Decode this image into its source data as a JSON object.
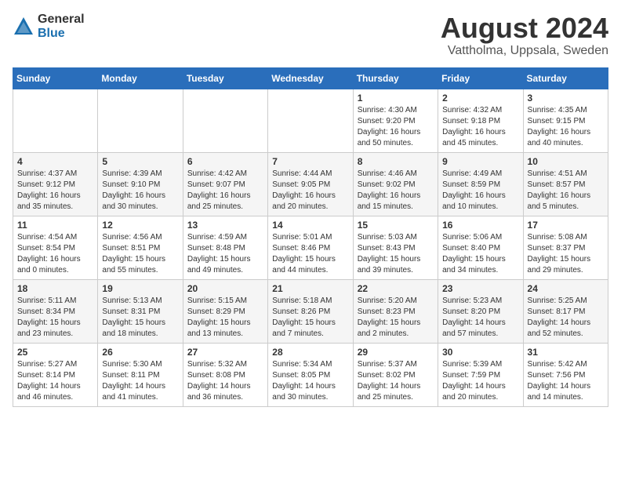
{
  "logo": {
    "general": "General",
    "blue": "Blue"
  },
  "title": "August 2024",
  "location": "Vattholma, Uppsala, Sweden",
  "days_header": [
    "Sunday",
    "Monday",
    "Tuesday",
    "Wednesday",
    "Thursday",
    "Friday",
    "Saturday"
  ],
  "weeks": [
    [
      {
        "day": "",
        "info": ""
      },
      {
        "day": "",
        "info": ""
      },
      {
        "day": "",
        "info": ""
      },
      {
        "day": "",
        "info": ""
      },
      {
        "day": "1",
        "info": "Sunrise: 4:30 AM\nSunset: 9:20 PM\nDaylight: 16 hours\nand 50 minutes."
      },
      {
        "day": "2",
        "info": "Sunrise: 4:32 AM\nSunset: 9:18 PM\nDaylight: 16 hours\nand 45 minutes."
      },
      {
        "day": "3",
        "info": "Sunrise: 4:35 AM\nSunset: 9:15 PM\nDaylight: 16 hours\nand 40 minutes."
      }
    ],
    [
      {
        "day": "4",
        "info": "Sunrise: 4:37 AM\nSunset: 9:12 PM\nDaylight: 16 hours\nand 35 minutes."
      },
      {
        "day": "5",
        "info": "Sunrise: 4:39 AM\nSunset: 9:10 PM\nDaylight: 16 hours\nand 30 minutes."
      },
      {
        "day": "6",
        "info": "Sunrise: 4:42 AM\nSunset: 9:07 PM\nDaylight: 16 hours\nand 25 minutes."
      },
      {
        "day": "7",
        "info": "Sunrise: 4:44 AM\nSunset: 9:05 PM\nDaylight: 16 hours\nand 20 minutes."
      },
      {
        "day": "8",
        "info": "Sunrise: 4:46 AM\nSunset: 9:02 PM\nDaylight: 16 hours\nand 15 minutes."
      },
      {
        "day": "9",
        "info": "Sunrise: 4:49 AM\nSunset: 8:59 PM\nDaylight: 16 hours\nand 10 minutes."
      },
      {
        "day": "10",
        "info": "Sunrise: 4:51 AM\nSunset: 8:57 PM\nDaylight: 16 hours\nand 5 minutes."
      }
    ],
    [
      {
        "day": "11",
        "info": "Sunrise: 4:54 AM\nSunset: 8:54 PM\nDaylight: 16 hours\nand 0 minutes."
      },
      {
        "day": "12",
        "info": "Sunrise: 4:56 AM\nSunset: 8:51 PM\nDaylight: 15 hours\nand 55 minutes."
      },
      {
        "day": "13",
        "info": "Sunrise: 4:59 AM\nSunset: 8:48 PM\nDaylight: 15 hours\nand 49 minutes."
      },
      {
        "day": "14",
        "info": "Sunrise: 5:01 AM\nSunset: 8:46 PM\nDaylight: 15 hours\nand 44 minutes."
      },
      {
        "day": "15",
        "info": "Sunrise: 5:03 AM\nSunset: 8:43 PM\nDaylight: 15 hours\nand 39 minutes."
      },
      {
        "day": "16",
        "info": "Sunrise: 5:06 AM\nSunset: 8:40 PM\nDaylight: 15 hours\nand 34 minutes."
      },
      {
        "day": "17",
        "info": "Sunrise: 5:08 AM\nSunset: 8:37 PM\nDaylight: 15 hours\nand 29 minutes."
      }
    ],
    [
      {
        "day": "18",
        "info": "Sunrise: 5:11 AM\nSunset: 8:34 PM\nDaylight: 15 hours\nand 23 minutes."
      },
      {
        "day": "19",
        "info": "Sunrise: 5:13 AM\nSunset: 8:31 PM\nDaylight: 15 hours\nand 18 minutes."
      },
      {
        "day": "20",
        "info": "Sunrise: 5:15 AM\nSunset: 8:29 PM\nDaylight: 15 hours\nand 13 minutes."
      },
      {
        "day": "21",
        "info": "Sunrise: 5:18 AM\nSunset: 8:26 PM\nDaylight: 15 hours\nand 7 minutes."
      },
      {
        "day": "22",
        "info": "Sunrise: 5:20 AM\nSunset: 8:23 PM\nDaylight: 15 hours\nand 2 minutes."
      },
      {
        "day": "23",
        "info": "Sunrise: 5:23 AM\nSunset: 8:20 PM\nDaylight: 14 hours\nand 57 minutes."
      },
      {
        "day": "24",
        "info": "Sunrise: 5:25 AM\nSunset: 8:17 PM\nDaylight: 14 hours\nand 52 minutes."
      }
    ],
    [
      {
        "day": "25",
        "info": "Sunrise: 5:27 AM\nSunset: 8:14 PM\nDaylight: 14 hours\nand 46 minutes."
      },
      {
        "day": "26",
        "info": "Sunrise: 5:30 AM\nSunset: 8:11 PM\nDaylight: 14 hours\nand 41 minutes."
      },
      {
        "day": "27",
        "info": "Sunrise: 5:32 AM\nSunset: 8:08 PM\nDaylight: 14 hours\nand 36 minutes."
      },
      {
        "day": "28",
        "info": "Sunrise: 5:34 AM\nSunset: 8:05 PM\nDaylight: 14 hours\nand 30 minutes."
      },
      {
        "day": "29",
        "info": "Sunrise: 5:37 AM\nSunset: 8:02 PM\nDaylight: 14 hours\nand 25 minutes."
      },
      {
        "day": "30",
        "info": "Sunrise: 5:39 AM\nSunset: 7:59 PM\nDaylight: 14 hours\nand 20 minutes."
      },
      {
        "day": "31",
        "info": "Sunrise: 5:42 AM\nSunset: 7:56 PM\nDaylight: 14 hours\nand 14 minutes."
      }
    ]
  ]
}
